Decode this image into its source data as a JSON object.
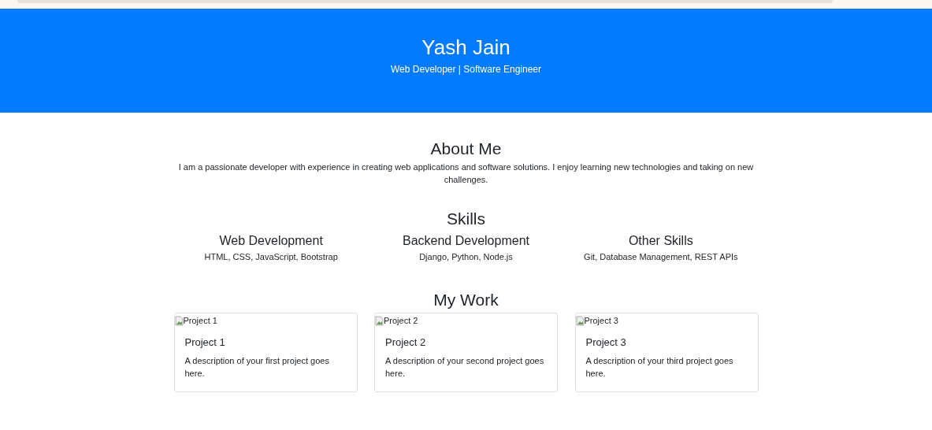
{
  "header": {
    "name": "Yash Jain",
    "tagline": "Web Developer | Software Engineer"
  },
  "about": {
    "heading": "About Me",
    "text": "I am a passionate developer with experience in creating web applications and software solutions. I enjoy learning new technologies and taking on new challenges."
  },
  "skills": {
    "heading": "Skills",
    "items": [
      {
        "title": "Web Development",
        "text": "HTML, CSS, JavaScript, Bootstrap"
      },
      {
        "title": "Backend Development",
        "text": "Django, Python, Node.js"
      },
      {
        "title": "Other Skills",
        "text": "Git, Database Management, REST APIs"
      }
    ]
  },
  "work": {
    "heading": "My Work",
    "projects": [
      {
        "image_alt": "Project 1",
        "title": "Project 1",
        "description": "A description of your first project goes here."
      },
      {
        "image_alt": "Project 2",
        "title": "Project 2",
        "description": "A description of your second project goes here."
      },
      {
        "image_alt": "Project 3",
        "title": "Project 3",
        "description": "A description of your third project goes here."
      }
    ]
  }
}
